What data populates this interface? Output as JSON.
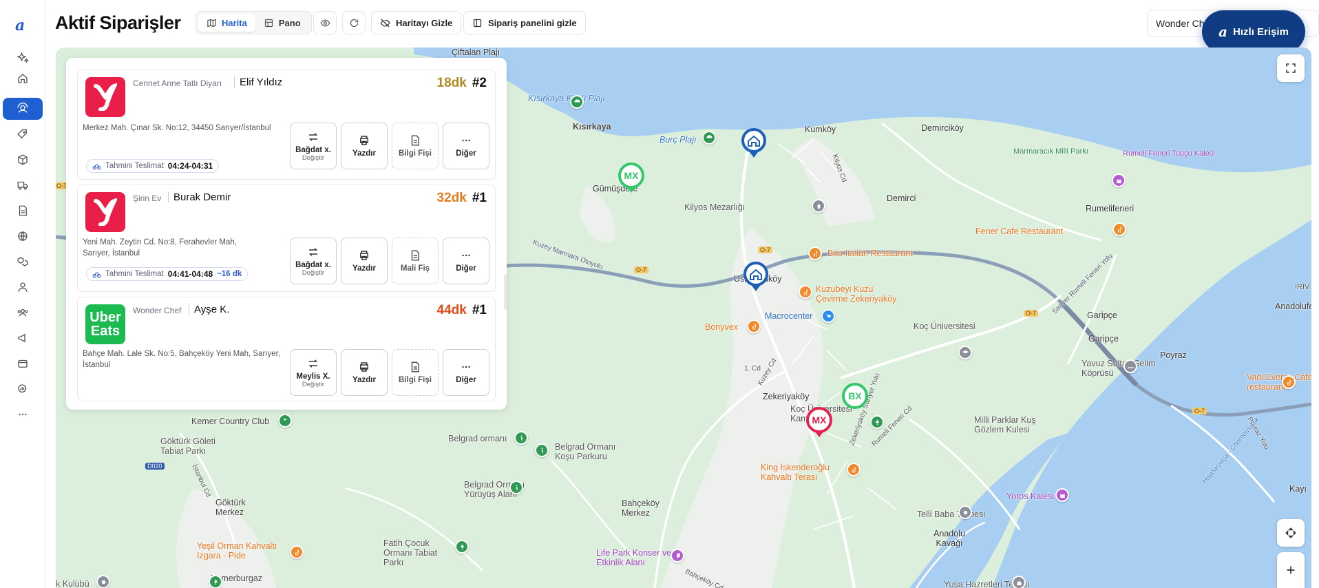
{
  "page": {
    "title": "Aktif Siparişler"
  },
  "toolbar": {
    "map_label": "Harita",
    "board_label": "Pano",
    "hide_map_label": "Haritayı Gizle",
    "hide_panel_label": "Sipariş panelini gizle",
    "restaurant_value": "Wonder Chef",
    "quick_access_label": "Hızlı Erişim"
  },
  "colors": {
    "accent": "#1f5fd1",
    "eta_yellow": "#b08a1e",
    "eta_orange": "#e67b1c",
    "eta_red": "#e24a18",
    "yemeksepeti": "#ea1f49",
    "ubereats": "#1bbb51"
  },
  "orders": [
    {
      "restaurant": "Cennet Anne Tatlı Diyarı",
      "customer": "Elif Yıldız",
      "eta": "18dk",
      "number": "#2",
      "address": "Merkez Mah. Çınar Sk. No:12, 34450 Sarıyer/İstanbul",
      "delivery_label": "Tahmini Teslimat",
      "delivery_time": "04:24-04:31",
      "courier": "Bağdat x.",
      "courier_sub": "Değiştir",
      "print": "Yazdır",
      "receipt": "Bilgi Fişi",
      "more": "Diğer"
    },
    {
      "restaurant": "Şirin Ev",
      "customer": "Burak Demir",
      "eta": "32dk",
      "number": "#1",
      "address": "Yeni Mah. Zeytin Cd. No:8, Ferahevler Mah, Sarıyer, İstanbul",
      "delivery_label": "Tahmini Teslimat",
      "delivery_time": "04:41-04:48",
      "distance": "~16 dk",
      "courier": "Bağdat x.",
      "courier_sub": "Değiştir",
      "print": "Yazdır",
      "receipt": "Mali Fiş",
      "more": "Diğer"
    },
    {
      "restaurant": "Wonder Chef",
      "customer": "Ayşe K.",
      "eta": "44dk",
      "number": "#1",
      "address": "Bahçe Mah. Lale Sk. No:5, Bahçeköy Yeni Mah, Sarıyer, İstanbul",
      "courier": "Meylis X.",
      "courier_sub": "Değiştir",
      "print": "Yazdır",
      "receipt": "Bilgi Fişi",
      "more": "Diğer",
      "logo_text_1": "Uber",
      "logo_text_2": "Eats"
    }
  ],
  "map": {
    "places": [
      "Çiftalan Plajı",
      "Kısırkaya Köyü Plajı",
      "Kısırkaya",
      "Burç Plajı",
      "Kumköy",
      "Demirciköy",
      "Marmaracık Milli Parkı",
      "Rumeli Feneri Topçu Kalesi",
      "Rumelifeneri",
      "Gümüşdere",
      "Kilyos Mezarlığı",
      "Demirci",
      "Fener Cafe Restaurant",
      "Brio Italian Restaurant",
      "Uskumruköy",
      "Kuzubeyi Kuzu Çevirme Zekeriyaköy",
      "Macrocenter",
      "Bonyvex",
      "Garipçe",
      "Garipçe",
      "Koç Üniversitesi",
      "Yavuz Sultan Selim Köprüsü",
      "Poyraz",
      "Vadi Events Cafe-restaurant",
      "Anadolufe",
      "Zekeriyaköy",
      "Koç Üniversitesi Kampüsü",
      "Milli Parklar Kuş Gözlem Kulesi",
      "Kemer Country Club",
      "Belgrad ormanı",
      "Belgrad Ormanı Koşu Parkuru",
      "Göktürk Göleti Tabiat Parkı",
      "King İskenderoğlu Kahvaltı Terası",
      "Belgrad Ormanı Yürüyüş Alanı",
      "Göktürk Merkez",
      "Bahçeköy Merkez",
      "Yoros Kalesi",
      "Telli Baba Türbesi",
      "Anadolu Kavağı",
      "Kayı",
      "Yeşil Orman Kahvaltı Izgara - Pide",
      "Fatih Çocuk Ormanı Tabiat Parkı",
      "Life Park Konser ve Etkinlik Alanı",
      "Kemerburgaz",
      "k Kulübü",
      "Yuşa Hazretleri Tepesi",
      "IRIV",
      "Kuzey Marmara Otoyolu",
      "Sarıyer Rumeli Feneri Yolu",
      "Kilyos Cd",
      "Rumeli Feneri Cd",
      "Kuzey Cd",
      "İstanbul Cd",
      "Poyraz Yolu",
      "Haydarpaşa - Chomomorsk",
      "Zekeriyaköy Sarıyer Yolu",
      "Bahçeköy Cd",
      "1. Cd"
    ],
    "road_codes": [
      "O-7",
      "O-7",
      "O-7",
      "O-7",
      "O-7",
      "D020"
    ],
    "markers": [
      "MX",
      "MX",
      "BX"
    ]
  }
}
